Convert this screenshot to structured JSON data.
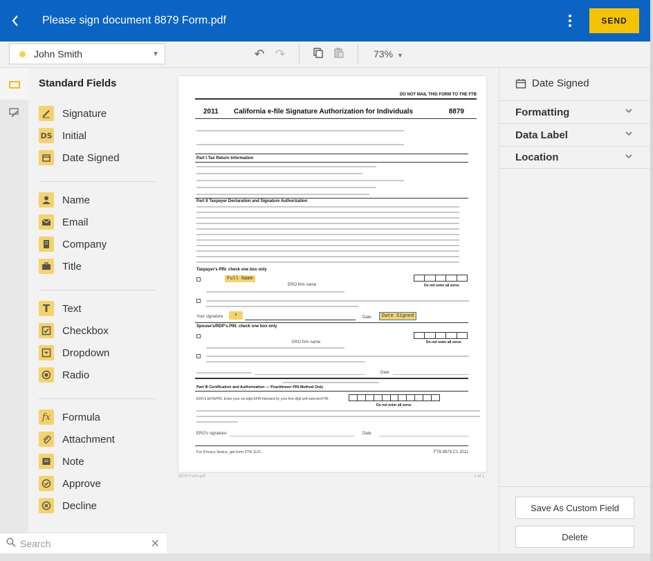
{
  "header": {
    "title": "Please sign document 8879 Form.pdf",
    "send_label": "SEND"
  },
  "signer": {
    "name": "John Smith"
  },
  "toolbar": {
    "zoom": "73%"
  },
  "fields_panel": {
    "title": "Standard Fields",
    "groups": [
      [
        {
          "label": "Signature",
          "icon": "signature-icon"
        },
        {
          "label": "Initial",
          "icon": "initial-icon",
          "glyph": "DS"
        },
        {
          "label": "Date Signed",
          "icon": "calendar-icon"
        }
      ],
      [
        {
          "label": "Name",
          "icon": "person-icon"
        },
        {
          "label": "Email",
          "icon": "envelope-icon"
        },
        {
          "label": "Company",
          "icon": "building-icon"
        },
        {
          "label": "Title",
          "icon": "briefcase-icon"
        }
      ],
      [
        {
          "label": "Text",
          "icon": "text-icon",
          "glyph": "T"
        },
        {
          "label": "Checkbox",
          "icon": "checkbox-icon"
        },
        {
          "label": "Dropdown",
          "icon": "dropdown-icon"
        },
        {
          "label": "Radio",
          "icon": "radio-icon"
        }
      ],
      [
        {
          "label": "Formula",
          "icon": "formula-icon",
          "glyph": "fx"
        },
        {
          "label": "Attachment",
          "icon": "paperclip-icon"
        },
        {
          "label": "Note",
          "icon": "note-icon"
        },
        {
          "label": "Approve",
          "icon": "check-circle-icon"
        },
        {
          "label": "Decline",
          "icon": "x-circle-icon"
        }
      ]
    ]
  },
  "search": {
    "placeholder": "Search"
  },
  "document": {
    "top_note": "DO NOT MAIL THIS FORM TO THE FTB",
    "year": "2011",
    "form_title": "California e-file Signature Authorization for Individuals",
    "form_number": "8879",
    "part1": "Part I   Tax Return Information",
    "part2": "Part II   Taxpayer Declaration and Signature Authorization",
    "taxpayer_pin": "Taxpayer's PIN: check one box only",
    "spouse_pin": "Spouse's/RDP's PIN: check one box only",
    "ero_firm_name": "ERO firm name",
    "do_not_enter": "Do not enter all zeros",
    "your_signature": "Your signature",
    "date_label": "Date",
    "part3": "Part III   Certification and Authorization — Practitioner PIN Method Only",
    "ero_efin": "ERO's EFIN/PIN. Enter your six-digit EFIN followed by your five-digit self-selected PIN.",
    "ero_signature": "ERO's signature",
    "privacy": "For Privacy Notice, get form FTB 1131.",
    "footer_code": "FTB 8879 C1  2011",
    "tag_full_name": "Full Name",
    "tag_date_signed": "Date Signed",
    "page_name": "8879 Form.pdf",
    "page_count": "1 of 1"
  },
  "right_panel": {
    "title": "Date Signed",
    "sections": [
      "Formatting",
      "Data Label",
      "Location"
    ],
    "save_custom_label": "Save As Custom Field",
    "delete_label": "Delete"
  },
  "colors": {
    "header": "#0b63c4",
    "send": "#f5c300",
    "field_icon": "#f5d36b"
  }
}
